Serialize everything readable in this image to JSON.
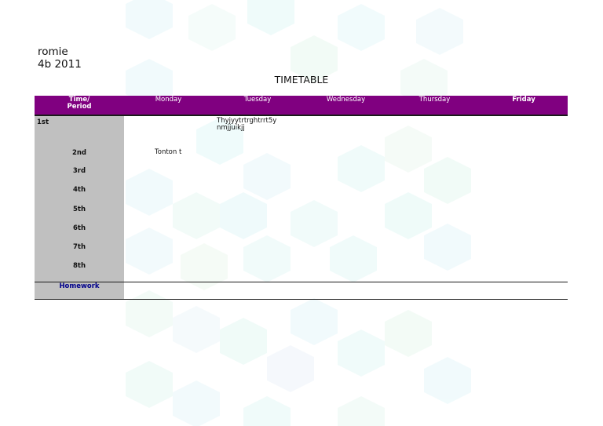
{
  "header": {
    "name": "romie",
    "class_year": "4b 2011",
    "title": "TIMETABLE"
  },
  "columns": {
    "time_line1": "Time/",
    "time_line2": "Period",
    "days": [
      "Monday",
      "Tuesday",
      "Wednesday",
      "Thursday",
      "Friday"
    ]
  },
  "periods": [
    "1st",
    "2nd",
    "3rd",
    "4th",
    "5th",
    "6th",
    "7th",
    "8th"
  ],
  "entries": {
    "tuesday_1st_line1": "Thyjyytrtrghtrrt5y",
    "tuesday_1st_line2": "nmjjuikjj",
    "monday_2nd": "Tonton t"
  },
  "homework_label": "Homework",
  "colors": {
    "header_bg": "#800080",
    "period_bg": "#c0c0c0",
    "homework_text": "#00008b"
  }
}
